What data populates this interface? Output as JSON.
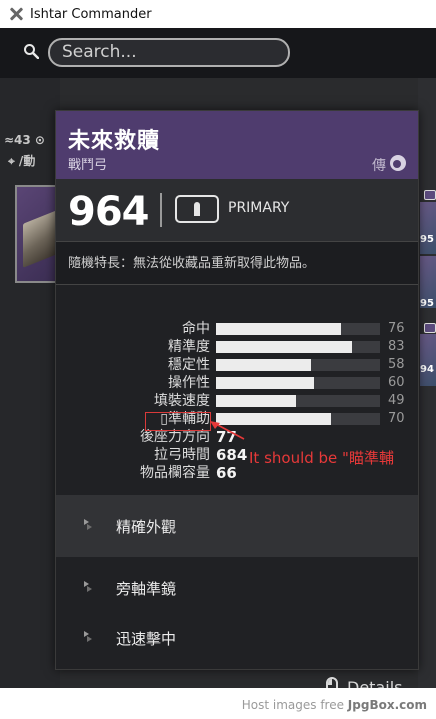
{
  "window": {
    "title": "Ishtar Commander"
  },
  "search": {
    "placeholder": "Search..."
  },
  "background": {
    "stats_text": "≈43  ⊙",
    "class_text": "⌖ /動",
    "right_numbers": [
      "95",
      "95",
      "94"
    ]
  },
  "item": {
    "name": "未來救贖",
    "type": "戰鬥弓",
    "rarity_text": "傳",
    "power": "964",
    "ammo": "PRIMARY",
    "perk_note": "隨機特長：無法從收藏品重新取得此物品。",
    "stats": [
      {
        "label": "命中",
        "value": 76,
        "bar": true
      },
      {
        "label": "精準度",
        "value": 83,
        "bar": true
      },
      {
        "label": "穩定性",
        "value": 58,
        "bar": true
      },
      {
        "label": "操作性",
        "value": 60,
        "bar": true
      },
      {
        "label": "填裝速度",
        "value": 49,
        "bar": true
      },
      {
        "label": "▯準輔助",
        "value": 70,
        "bar": true
      },
      {
        "label": "後座力方向",
        "value": 77,
        "bar": false
      },
      {
        "label": "拉弓時間",
        "value": 684,
        "bar": false
      },
      {
        "label": "物品欄容量",
        "value": 66,
        "bar": false
      }
    ],
    "annotation": "It should be \"瞄準輔",
    "sockets": [
      {
        "label": "精確外觀",
        "selected": true
      },
      {
        "label": "旁軸準鏡",
        "selected": false
      },
      {
        "label": "迅速擊中",
        "selected": false
      }
    ],
    "details_label": "Details"
  },
  "footer": {
    "text_prefix": "Host images free ",
    "brand": "JpgBox.com"
  },
  "colors": {
    "header": "#4f3c6e",
    "annotation": "#e63939",
    "bar_fill": "#ececec"
  }
}
